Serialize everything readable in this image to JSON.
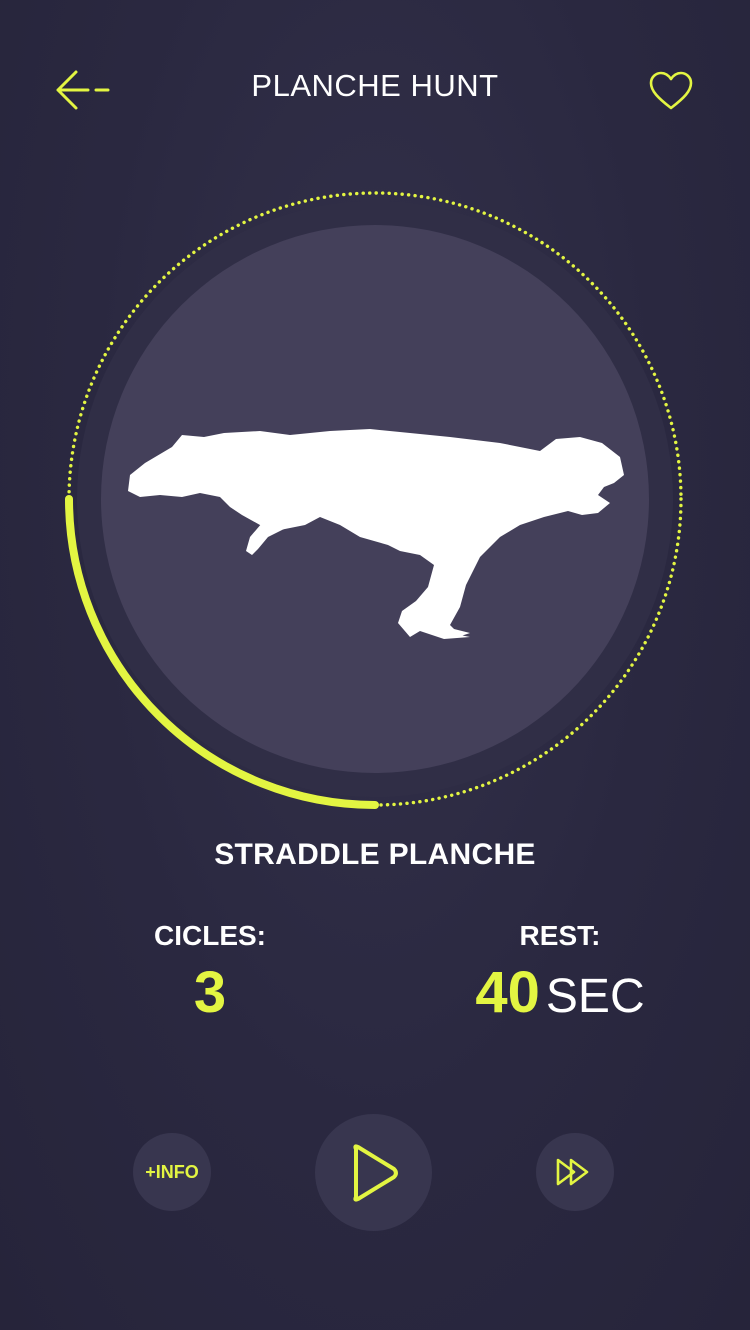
{
  "header": {
    "title": "PLANCHE HUNT",
    "back_icon": "arrow-left-icon",
    "favorite_icon": "heart-icon"
  },
  "exercise": {
    "name": "STRADDLE PLANCHE",
    "image": "straddle-planche-silhouette",
    "timer_progress": 0.25
  },
  "stats": {
    "cicles_label": "CICLES:",
    "cicles_value": "3",
    "rest_label": "REST:",
    "rest_value": "40",
    "rest_unit": "SEC"
  },
  "controls": {
    "info_label": "+INFO",
    "play_icon": "play-icon",
    "skip_icon": "fast-forward-icon"
  },
  "colors": {
    "accent": "#e3f542",
    "background": "#2a2840",
    "circle": "#44405a",
    "button": "#38364f"
  }
}
